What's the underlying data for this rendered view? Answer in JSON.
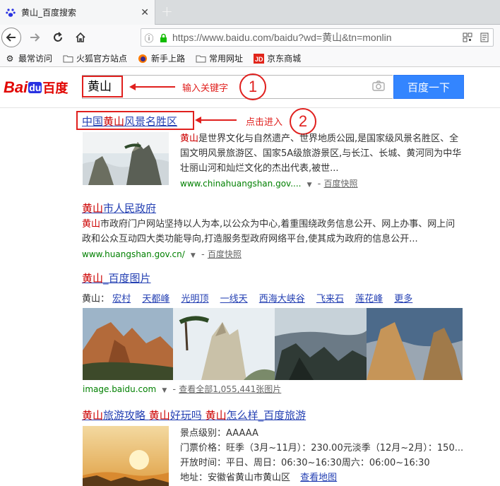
{
  "browser": {
    "tab_title": "黄山_百度搜索",
    "url": "https://www.baidu.com/baidu?wd=黄山&tn=monlin",
    "bookmarks": [
      "最常访问",
      "火狐官方站点",
      "新手上路",
      "常用网址",
      "京东商城"
    ]
  },
  "baidu": {
    "logo_bai": "Bai",
    "logo_du": "du",
    "logo_cn": "百度",
    "query": "黄山",
    "search_button": "百度一下"
  },
  "annotations": {
    "step1_text": "输入关键字",
    "step1_num": "1",
    "step2_text": "点击进入",
    "step2_num": "2"
  },
  "results": [
    {
      "title_hl": "黄山",
      "title": "中国黄山风景名胜区",
      "abstract_hl": "黄山",
      "abstract_line1": "是世界文化与自然遗产、世界地质公园,是国家级风景名胜区、全",
      "abstract_line2": "国文明风景旅游区、国家5A级旅游景区,与长江、长城、黄河同为中华",
      "abstract_line3": "壮丽山河和灿烂文化的杰出代表,被世...",
      "cite": "www.chinahuangshan.gov....",
      "snapshot": "百度快照"
    },
    {
      "title_hl": "黄山",
      "title_rest": "市人民政府",
      "abstract_hl": "黄山",
      "abstract_line1": "市政府门户网站坚持以人为本,以公众为中心,着重围绕政务信息公开、网上办事、网上问",
      "abstract_line2": "政和公众互动四大类功能导向,打造服务型政府网络平台,使其成为政府的信息公开...",
      "cite": "www.huangshan.gov.cn/",
      "snapshot": "百度快照"
    },
    {
      "title_hl": "黄山",
      "title_rest": "_百度图片",
      "tags_label": "黄山：",
      "tags": [
        "宏村",
        "天都峰",
        "光明顶",
        "一线天",
        "西海大峡谷",
        "飞来石",
        "莲花峰",
        "更多"
      ],
      "cite": "image.baidu.com",
      "more_images": "查看全部1,055,441张图片"
    },
    {
      "title_parts": [
        "黄山",
        "旅游攻略 ",
        "黄山",
        "好玩吗 ",
        "黄山",
        "怎么样_百度旅游"
      ],
      "info": [
        {
          "label": "景点级别：",
          "value": "AAAAA"
        },
        {
          "label": "门票价格：",
          "value": "旺季（3月~11月）：230.00元淡季（12月~2月）：150..."
        },
        {
          "label": "开放时间：",
          "value": "平日、周日：06:30~16:30周六：06:00~16:30"
        },
        {
          "label": "地址：",
          "value": "安徽省黄山市黄山区",
          "link": "查看地图"
        }
      ]
    }
  ],
  "colors": {
    "link": "#2440b3",
    "highlight": "#c00",
    "cite": "#008000",
    "annotation": "#e0201e",
    "search_button": "#3385ff"
  }
}
